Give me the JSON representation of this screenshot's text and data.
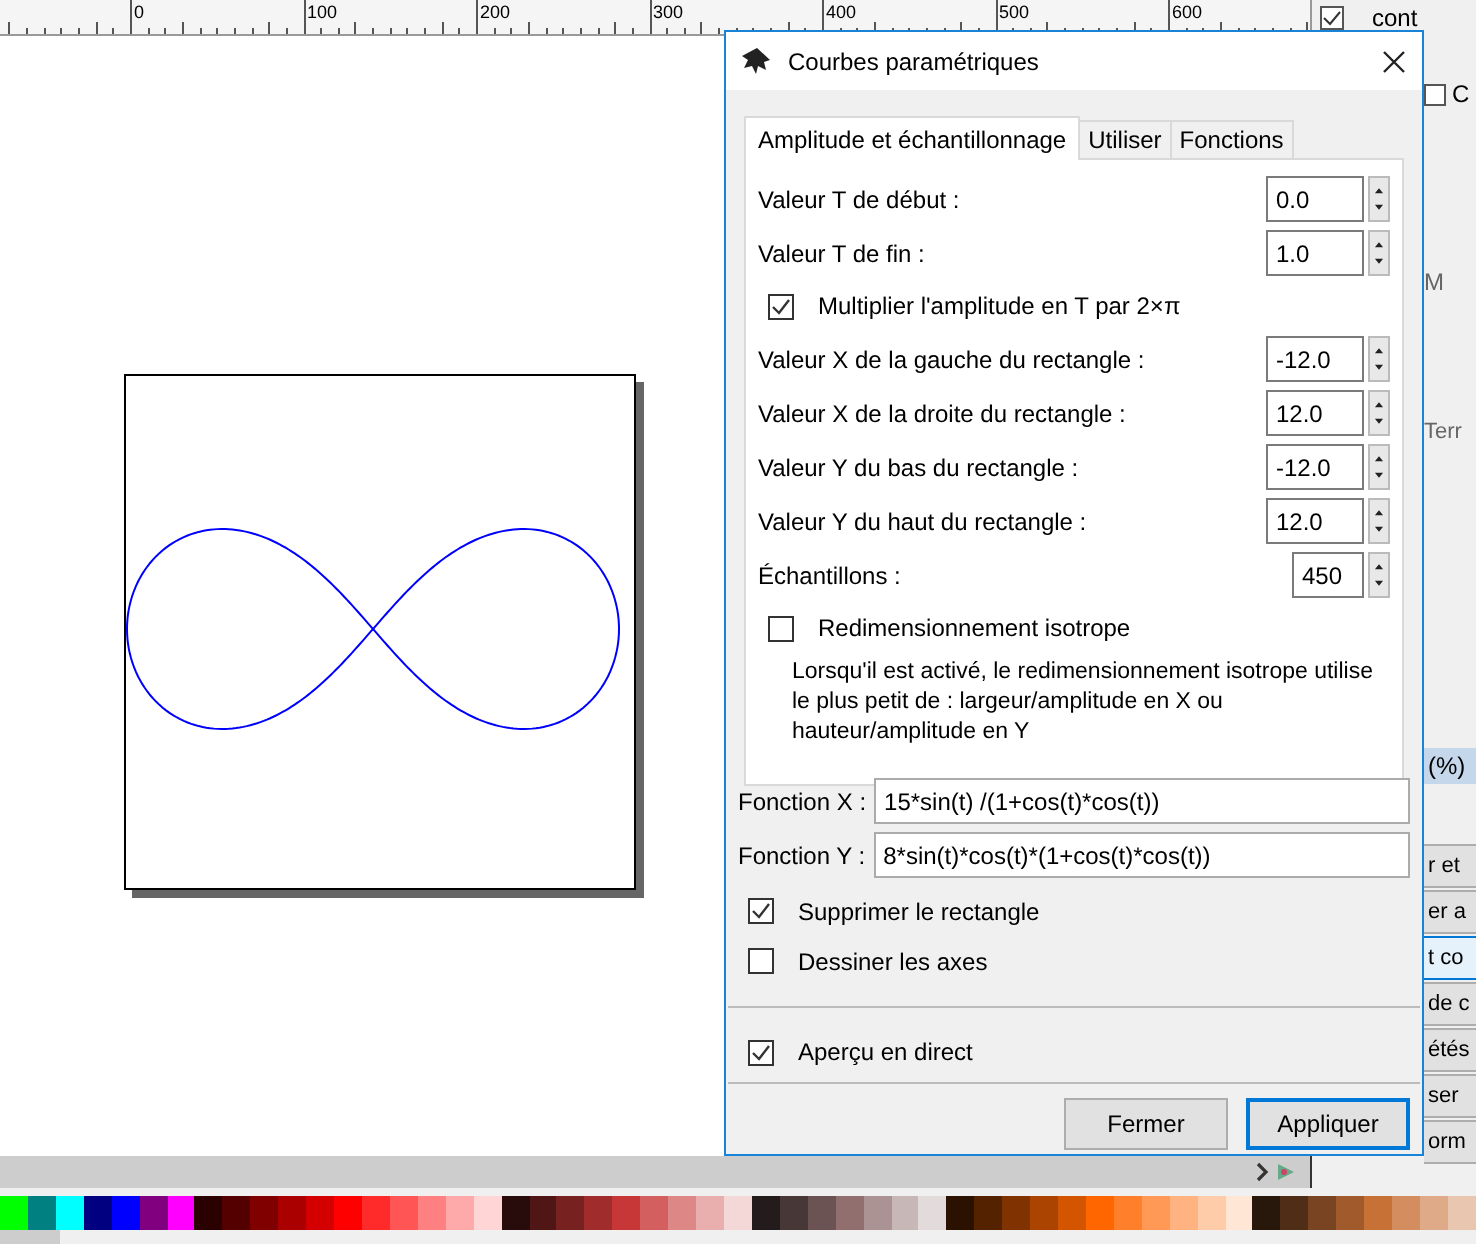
{
  "ruler": {
    "labels": [
      "0",
      "100",
      "200",
      "300",
      "400",
      "500",
      "600"
    ]
  },
  "dialog": {
    "title": "Courbes paramétriques",
    "tabs": [
      {
        "label": "Amplitude et échantillonnage",
        "selected": true
      },
      {
        "label": "Utiliser",
        "selected": false
      },
      {
        "label": "Fonctions",
        "selected": false
      }
    ],
    "rows": [
      {
        "kind": "spin",
        "label": "Valeur T de début :",
        "value": "0.0"
      },
      {
        "kind": "spin",
        "label": "Valeur T de fin :",
        "value": "1.0"
      },
      {
        "kind": "checkbox",
        "label": "Multiplier l'amplitude en T par 2×π",
        "checked": true
      },
      {
        "kind": "spin",
        "label": "Valeur X de la gauche du rectangle :",
        "value": "-12.0"
      },
      {
        "kind": "spin",
        "label": "Valeur X de la droite du rectangle :",
        "value": "12.0"
      },
      {
        "kind": "spin",
        "label": "Valeur Y du bas du rectangle :",
        "value": "-12.0"
      },
      {
        "kind": "spin",
        "label": "Valeur Y du haut du rectangle :",
        "value": "12.0"
      },
      {
        "kind": "spin_small",
        "label": "Échantillons :",
        "value": "450"
      },
      {
        "kind": "checkbox",
        "label": "Redimensionnement isotrope",
        "checked": false
      },
      {
        "kind": "note",
        "text": "Lorsqu'il est activé, le redimensionnement isotrope utilise le plus petit de : largeur/amplitude en X ou hauteur/amplitude en Y"
      }
    ],
    "functions": [
      {
        "label": "Fonction X :",
        "value": "15*sin(t) /(1+cos(t)*cos(t))"
      },
      {
        "label": "Fonction Y :",
        "value": "8*sin(t)*cos(t)*(1+cos(t)*cos(t))"
      }
    ],
    "options": [
      {
        "label": "Supprimer le rectangle",
        "checked": true
      },
      {
        "label": "Dessiner les axes",
        "checked": false
      }
    ],
    "live_preview": {
      "label": "Aperçu en direct",
      "checked": true
    },
    "buttons": [
      {
        "label": "Fermer",
        "default": false
      },
      {
        "label": "Appliquer",
        "default": true
      }
    ]
  },
  "right_panel": {
    "top_label": "cont",
    "checkbox": {
      "label": "C",
      "checked": false
    },
    "labels": [
      "M",
      "Terr"
    ],
    "header": "(%)",
    "items": [
      {
        "label": "r et",
        "selected": false
      },
      {
        "label": "er a",
        "selected": false
      },
      {
        "label": "t co",
        "selected": true
      },
      {
        "label": "de c",
        "selected": false
      },
      {
        "label": "étés",
        "selected": false
      },
      {
        "label": "ser",
        "selected": false
      },
      {
        "label": "orm",
        "selected": false
      }
    ]
  },
  "palette": [
    {
      "color": "#00ff00"
    },
    {
      "color": "#008080"
    },
    {
      "color": "#00ffff"
    },
    {
      "color": "#000080"
    },
    {
      "color": "#0000ff"
    },
    {
      "color": "#800080"
    },
    {
      "color": "#ff00ff"
    },
    {
      "color": "#2b0000"
    },
    {
      "color": "#550000"
    },
    {
      "color": "#800000"
    },
    {
      "color": "#aa0000"
    },
    {
      "color": "#d40000"
    },
    {
      "color": "#ff0000"
    },
    {
      "color": "#ff2a2a"
    },
    {
      "color": "#ff5555"
    },
    {
      "color": "#ff8080"
    },
    {
      "color": "#ffaaaa"
    },
    {
      "color": "#ffd5d5"
    },
    {
      "color": "#280b0b"
    },
    {
      "color": "#501616"
    },
    {
      "color": "#782121"
    },
    {
      "color": "#a02c2c"
    },
    {
      "color": "#c83737"
    },
    {
      "color": "#d35f5f"
    },
    {
      "color": "#de8787"
    },
    {
      "color": "#e9afaf"
    },
    {
      "color": "#f4d7d7"
    },
    {
      "color": "#241c1c"
    },
    {
      "color": "#483737"
    },
    {
      "color": "#6c5353"
    },
    {
      "color": "#916f6f"
    },
    {
      "color": "#ac9393"
    },
    {
      "color": "#c8b7b7"
    },
    {
      "color": "#e3dbdb"
    },
    {
      "color": "#2b1100"
    },
    {
      "color": "#552200"
    },
    {
      "color": "#803300"
    },
    {
      "color": "#aa4400"
    },
    {
      "color": "#d45500"
    },
    {
      "color": "#ff6600"
    },
    {
      "color": "#ff7f2a"
    },
    {
      "color": "#ff9955"
    },
    {
      "color": "#ffb380"
    },
    {
      "color": "#ffccaa"
    },
    {
      "color": "#ffe6d5"
    },
    {
      "color": "#28170b"
    },
    {
      "color": "#502d16"
    },
    {
      "color": "#784421"
    },
    {
      "color": "#a05a2c"
    },
    {
      "color": "#c87137"
    },
    {
      "color": "#d38d5f"
    },
    {
      "color": "#deaa87"
    },
    {
      "color": "#e9c6af"
    }
  ]
}
